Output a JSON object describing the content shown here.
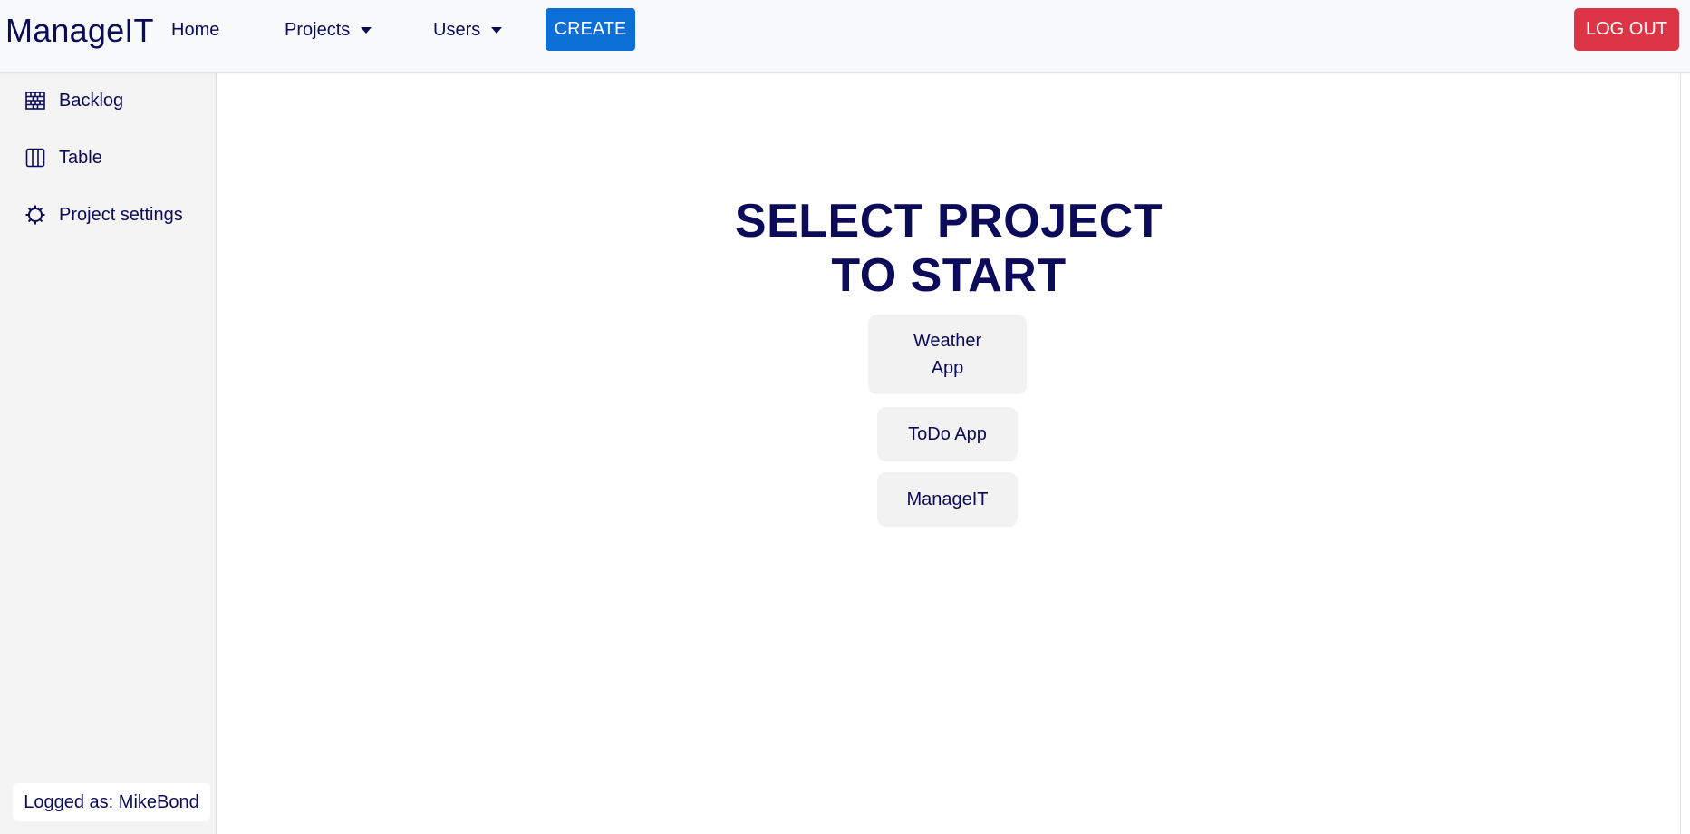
{
  "navbar": {
    "brand": "ManageIT",
    "home": "Home",
    "projects": "Projects",
    "users": "Users",
    "create": "CREATE",
    "logout": "LOG OUT"
  },
  "sidebar": {
    "items": [
      {
        "label": "Backlog",
        "icon": "backlog-icon"
      },
      {
        "label": "Table",
        "icon": "table-icon"
      },
      {
        "label": "Project settings",
        "icon": "gear-icon"
      }
    ],
    "logged_as": "Logged as: MikeBond"
  },
  "main": {
    "title_line1": "SELECT PROJECT",
    "title_line2": "TO START",
    "projects": [
      {
        "line1": "Weather",
        "line2": "App"
      },
      {
        "label": "ToDo App"
      },
      {
        "label": "ManageIT"
      }
    ]
  },
  "colors": {
    "primary_text": "#0b0b5a",
    "create_button": "#0b6fd6",
    "logout_button": "#dc3545",
    "navbar_bg": "#f8f9fa",
    "sidebar_bg": "#f4f4f5"
  }
}
